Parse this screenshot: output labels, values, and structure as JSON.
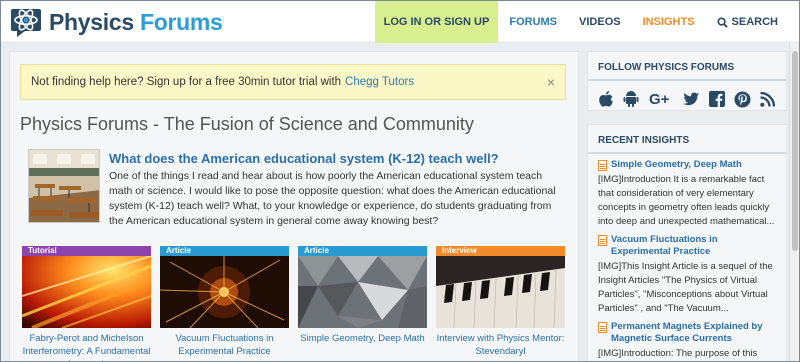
{
  "header": {
    "logo_word1": "Physics",
    "logo_word2": "Forums",
    "nav": {
      "login": "LOG IN OR SIGN UP",
      "forums": "FORUMS",
      "videos": "VIDEOS",
      "insights": "INSIGHTS",
      "search": "SEARCH"
    }
  },
  "banner": {
    "text": "Not finding help here? Sign up for a free 30min tutor trial with",
    "link": "Chegg Tutors",
    "close": "×"
  },
  "main": {
    "title": "Physics Forums - The Fusion of Science and Community",
    "featured": {
      "title": "What does the American educational system (K-12) teach well?",
      "text": "One of the things I read and hear about is how poorly the American educational system teach math or science. I would like to pose the opposite question: what does the American educational system (K-12) teach well? What, to your knowledge or experience, do students graduating from the American educational system in general come away knowing best?"
    },
    "cards": [
      {
        "tag": "Tutorial",
        "caption": "Fabry-Perot and Michelson Interferometry: A Fundamental Approach",
        "color": "#8e44ad"
      },
      {
        "tag": "Article",
        "caption": "Vacuum Fluctuations in Experimental Practice",
        "color": "#2a9bd1"
      },
      {
        "tag": "Article",
        "caption": "Simple Geometry, Deep Math",
        "color": "#2a9bd1"
      },
      {
        "tag": "Interview",
        "caption": "Interview with Physics Mentor: Stevendaryl",
        "color": "#f08a2b"
      }
    ]
  },
  "sidebar": {
    "follow_heading": "FOLLOW PHYSICS FORUMS",
    "social_icons": [
      "apple-icon",
      "android-icon",
      "google-plus-icon",
      "twitter-icon",
      "facebook-icon",
      "pinterest-icon",
      "rss-icon"
    ],
    "recent_heading": "RECENT INSIGHTS",
    "insights": [
      {
        "title": "Simple Geometry, Deep Math",
        "text": "[IMG]Introduction It is a remarkable fact that consideration of very elementary concepts in geometry often leads quickly into deep and unexpected mathematical..."
      },
      {
        "title": "Vacuum Fluctuations in Experimental Practice",
        "text": "[IMG]This Insight Article is a sequel of the Insight Articles \"The Physics of Virtual Particles\", \"Misconceptions about Virtual Particles\" , and \"The Vacuum..."
      },
      {
        "title": "Permanent Magnets Explained by Magnetic Surface Currents",
        "text": "[IMG]Introduction: The purpose of this Insight"
      }
    ]
  },
  "colors": {
    "brand_navy": "#2b4a66",
    "brand_blue": "#2d9cdb",
    "login_bg": "#d8ef8f",
    "insights_orange": "#f08a2b",
    "banner_bg": "#fcf7c7"
  }
}
